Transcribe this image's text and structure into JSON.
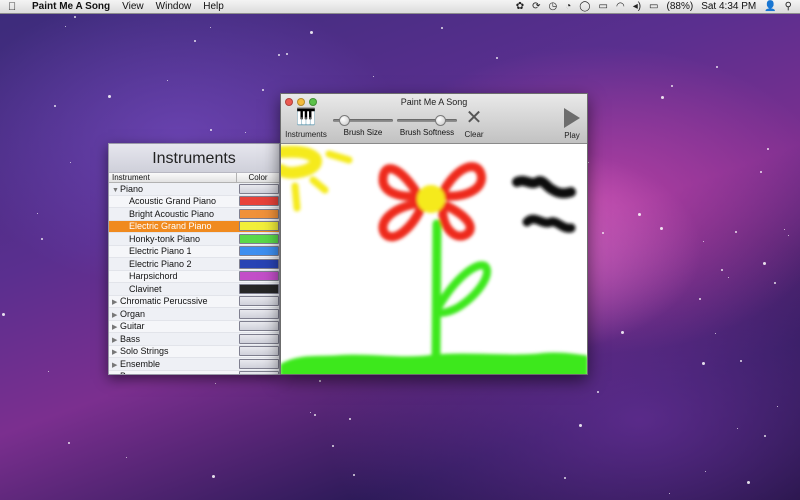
{
  "menubar": {
    "apple": "",
    "app_name": "Paint Me A Song",
    "menus": [
      "View",
      "Window",
      "Help"
    ],
    "status": {
      "battery": "(88%)",
      "clock": "Sat 4:34 PM"
    }
  },
  "instruments_panel": {
    "title": "Instruments",
    "col_instrument": "Instrument",
    "col_color": "Color",
    "rows": [
      {
        "label": "Piano",
        "type": "group",
        "expanded": true,
        "color": ""
      },
      {
        "label": "Acoustic Grand Piano",
        "type": "child",
        "color": "#e8423a"
      },
      {
        "label": "Bright Acoustic Piano",
        "type": "child",
        "color": "#f0913a"
      },
      {
        "label": "Electric Grand Piano",
        "type": "child",
        "color": "#f2ee3a",
        "selected": true
      },
      {
        "label": "Honky-tonk Piano",
        "type": "child",
        "color": "#59d94a"
      },
      {
        "label": "Electric Piano 1",
        "type": "child",
        "color": "#3d8ff0"
      },
      {
        "label": "Electric Piano 2",
        "type": "child",
        "color": "#2843b4"
      },
      {
        "label": "Harpsichord",
        "type": "child",
        "color": "#c24fc8"
      },
      {
        "label": "Clavinet",
        "type": "child",
        "color": "#262626"
      },
      {
        "label": "Chromatic Perucssive",
        "type": "group",
        "expanded": false,
        "color": ""
      },
      {
        "label": "Organ",
        "type": "group",
        "expanded": false,
        "color": ""
      },
      {
        "label": "Guitar",
        "type": "group",
        "expanded": false,
        "color": ""
      },
      {
        "label": "Bass",
        "type": "group",
        "expanded": false,
        "color": ""
      },
      {
        "label": "Solo Strings",
        "type": "group",
        "expanded": false,
        "color": ""
      },
      {
        "label": "Ensemble",
        "type": "group",
        "expanded": false,
        "color": ""
      },
      {
        "label": "Brass",
        "type": "group",
        "expanded": false,
        "color": ""
      }
    ]
  },
  "window": {
    "title": "Paint Me A Song",
    "toolbar": {
      "instruments": "Instruments",
      "brush_size": "Brush Size",
      "brush_size_value": 0.12,
      "brush_softness": "Brush Softness",
      "brush_softness_value": 0.78,
      "clear": "Clear",
      "play": "Play"
    }
  },
  "colors": {
    "selection": "#f08a1e",
    "paint_red": "#ee2a1a",
    "paint_yellow": "#f5ea1c",
    "paint_green": "#3ee81e",
    "paint_black": "#111111"
  },
  "icons": {
    "instruments": "piano-icon",
    "clear": "x-icon",
    "play": "play-icon"
  }
}
